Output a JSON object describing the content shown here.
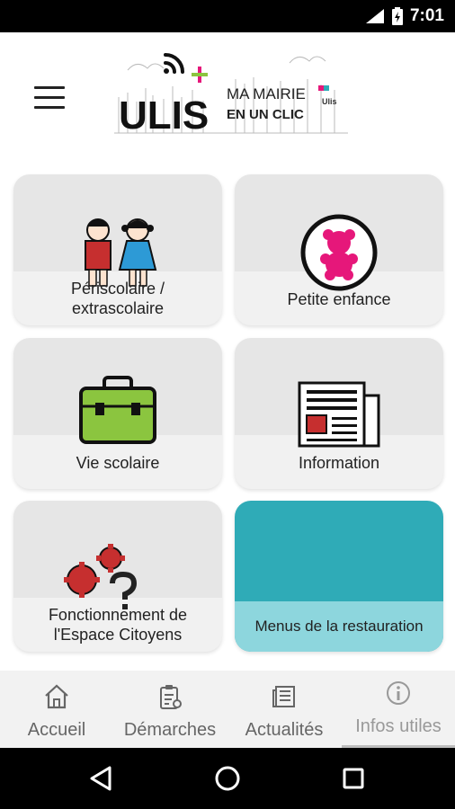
{
  "status_bar": {
    "time": "7:01"
  },
  "header": {
    "logo": {
      "brand": "ULIS",
      "tagline_line1": "MA MAIRIE",
      "tagline_line2": "EN UN CLIC",
      "small_mark": "Ulis"
    }
  },
  "tiles": [
    {
      "label": "Périscolaire / extrascolaire",
      "icon": "children-icon"
    },
    {
      "label": "Petite enfance",
      "icon": "teddy-bear-icon"
    },
    {
      "label": "Vie scolaire",
      "icon": "schoolbag-icon"
    },
    {
      "label": "Information",
      "icon": "newspaper-icon"
    },
    {
      "label": "Fonctionnement de l'Espace Citoyens",
      "icon": "gears-question-icon"
    },
    {
      "label": "Menus de la restauration",
      "icon": ""
    }
  ],
  "bottom_nav": [
    {
      "label": "Accueil",
      "icon": "home-icon",
      "active": false
    },
    {
      "label": "Démarches",
      "icon": "clipboard-icon",
      "active": false
    },
    {
      "label": "Actualités",
      "icon": "news-icon",
      "active": false
    },
    {
      "label": "Infos utiles",
      "icon": "info-icon",
      "active": true
    }
  ],
  "colors": {
    "status_bar": "#000000",
    "tile_grey": "#e6e6e6",
    "tile_teal": "#2fabb7",
    "tile_teal_light": "#8dd6dd",
    "accent_red": "#c62f2f",
    "accent_green": "#8bc53f",
    "accent_pink": "#e6177a"
  }
}
